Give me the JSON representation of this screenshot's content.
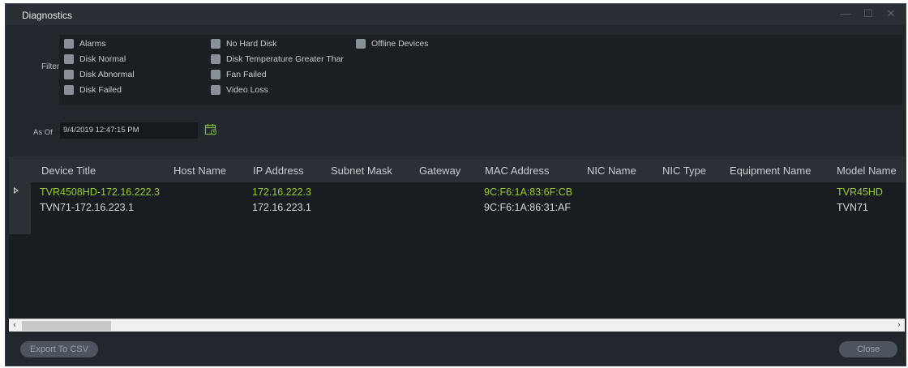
{
  "window": {
    "title": "Diagnostics"
  },
  "filters": {
    "label": "Filters",
    "items": [
      {
        "label": "Alarms",
        "checked": false
      },
      {
        "label": "Disk Normal",
        "checked": false
      },
      {
        "label": "Disk Abnormal",
        "checked": false
      },
      {
        "label": "Disk Failed",
        "checked": false
      },
      {
        "label": "No Hard Disk",
        "checked": false
      },
      {
        "label": "Disk Temperature Greater Thar",
        "checked": false
      },
      {
        "label": "Fan Failed",
        "checked": false
      },
      {
        "label": "Video Loss",
        "checked": false
      },
      {
        "label": "Offline Devices",
        "checked": false
      }
    ]
  },
  "as_of": {
    "label": "As Of",
    "value": "9/4/2019 12:47:15 PM",
    "icon": "calendar-icon"
  },
  "grid": {
    "columns": [
      "Device Title",
      "Host Name",
      "IP Address",
      "Subnet Mask",
      "Gateway",
      "MAC Address",
      "NIC Name",
      "NIC Type",
      "Equipment Name",
      "Model Name"
    ],
    "rows": [
      {
        "device_title": "TVR4508HD-172.16.222.3",
        "ip_address": "172.16.222.3",
        "mac_address": "9C:F6:1A:83:6F:CB",
        "model_name": "TVR45HD",
        "color": "#9acd32"
      },
      {
        "device_title": "TVN71-172.16.223.1",
        "ip_address": "172.16.223.1",
        "mac_address": "9C:F6:1A:86:31:AF",
        "model_name": "TVN71",
        "color": "#d2d6da"
      }
    ]
  },
  "buttons": {
    "export": "Export To CSV",
    "close": "Close"
  },
  "colors": {
    "background": "#22272e",
    "accent_green": "#9acd32"
  }
}
